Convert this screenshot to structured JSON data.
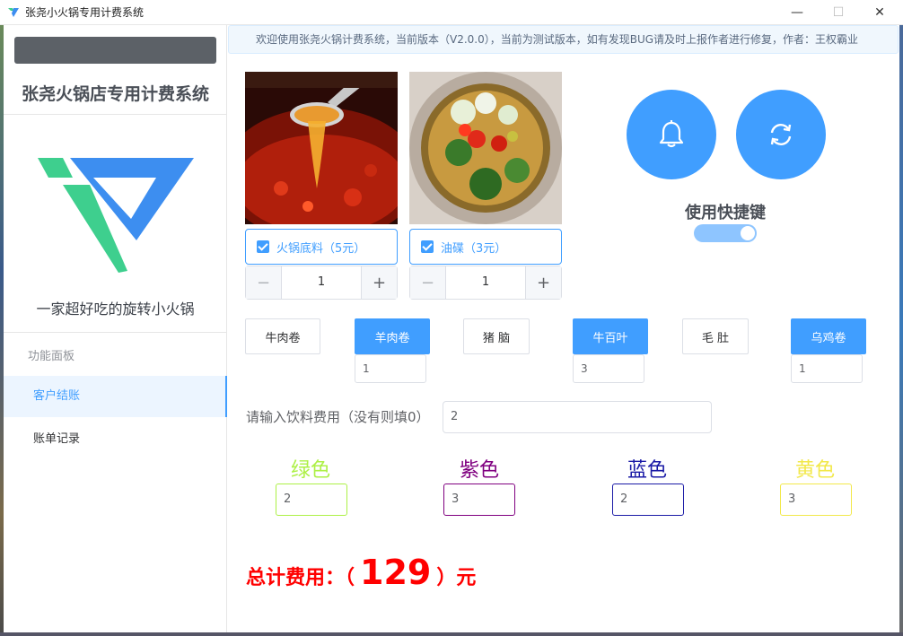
{
  "window": {
    "title": "张尧小火锅专用计费系统",
    "minimize": "—",
    "maximize": "☐",
    "close": "✕"
  },
  "sidebar": {
    "brand": "张尧火锅店专用计费系统",
    "slogan": "一家超好吃的旋转小火锅",
    "menu_group": "功能面板",
    "items": [
      {
        "label": "客户结账",
        "active": true
      },
      {
        "label": "账单记录",
        "active": false
      }
    ],
    "logo_colors": {
      "teal": "#3ecf8e",
      "blue": "#3d8ef0"
    }
  },
  "notice": "欢迎使用张尧火锅计费系统，当前版本（V2.0.0），当前为测试版本，如有发现BUG请及时上报作者进行修复，作者：王权霸业",
  "base_items": [
    {
      "label": "火锅底料（5元）",
      "checked": true,
      "quantity": "1",
      "image": "hotpot-soup-base-image"
    },
    {
      "label": "油碟（3元）",
      "checked": true,
      "quantity": "1",
      "image": "oil-dip-image"
    }
  ],
  "stepper": {
    "minus": "−",
    "plus": "+"
  },
  "shortcut": {
    "label": "使用快捷键",
    "enabled": true
  },
  "action_icons": [
    "bell-icon",
    "refresh-icon"
  ],
  "dishes": [
    {
      "label": "牛肉卷",
      "selected": false
    },
    {
      "label": "羊肉卷",
      "selected": true,
      "quantity": "1"
    },
    {
      "label": "猪 脑",
      "selected": false
    },
    {
      "label": "牛百叶",
      "selected": true,
      "quantity": "3"
    },
    {
      "label": "毛 肚",
      "selected": false
    },
    {
      "label": "乌鸡卷",
      "selected": true,
      "quantity": "1"
    }
  ],
  "drink": {
    "label": "请输入饮料费用（没有则填0）",
    "value": "2"
  },
  "plates": [
    {
      "label": "绿色",
      "value": "2",
      "color": "#adf046"
    },
    {
      "label": "紫色",
      "value": "3",
      "color": "#800080"
    },
    {
      "label": "蓝色",
      "value": "2",
      "color": "#1a1aa6"
    },
    {
      "label": "黄色",
      "value": "3",
      "color": "#f2e84a"
    }
  ],
  "total": {
    "prefix": "总计费用：（",
    "amount": "129",
    "suffix": "）元"
  },
  "colors": {
    "primary": "#409eff",
    "danger": "#ff0000"
  }
}
